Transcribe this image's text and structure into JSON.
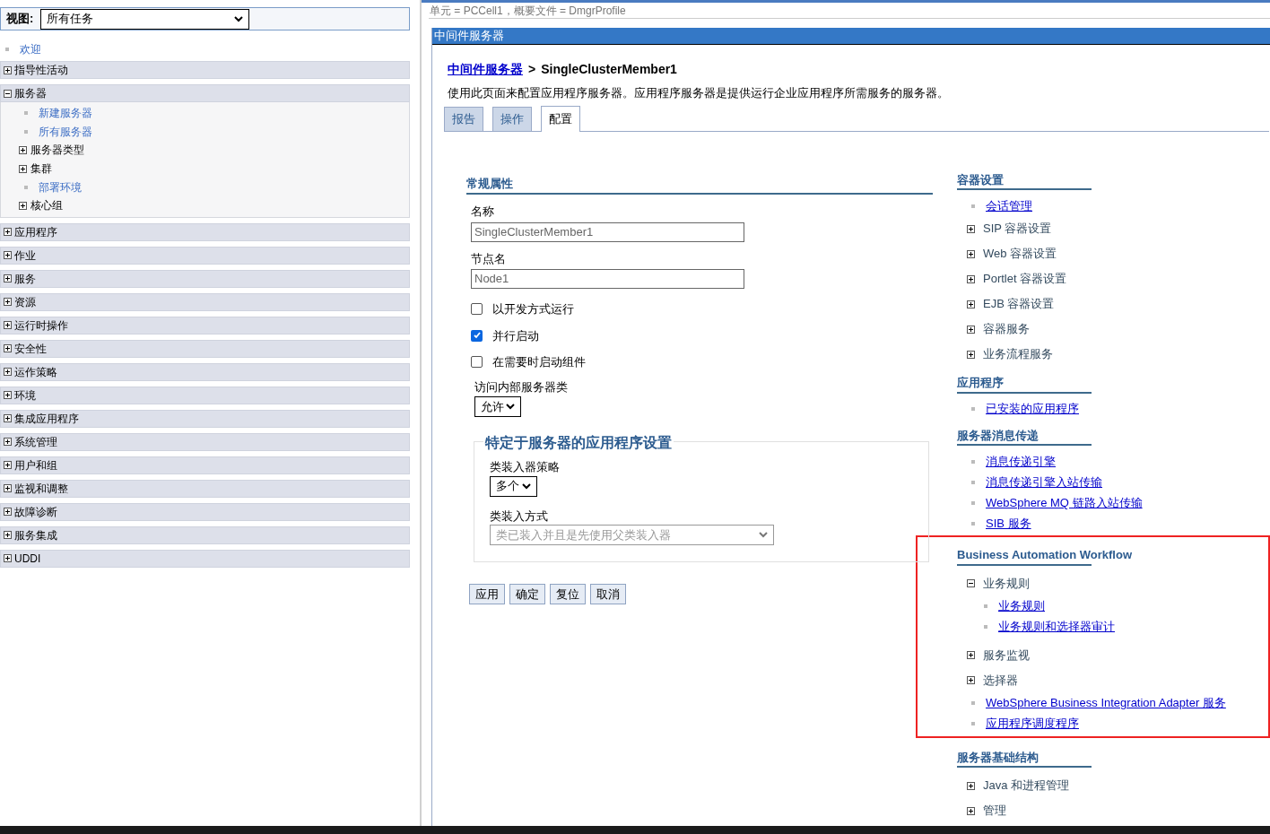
{
  "view": {
    "label": "视图:",
    "value": "所有任务"
  },
  "nav": [
    {
      "kind": "link",
      "label": "欢迎"
    },
    {
      "kind": "section",
      "label": "指导性活动",
      "expanded": false
    },
    {
      "kind": "section",
      "label": "服务器",
      "expanded": true,
      "children": [
        {
          "kind": "link",
          "label": "新建服务器"
        },
        {
          "kind": "link",
          "label": "所有服务器"
        },
        {
          "kind": "group",
          "label": "服务器类型",
          "expanded": false
        },
        {
          "kind": "group",
          "label": "集群",
          "expanded": false
        },
        {
          "kind": "link",
          "label": "部署环境"
        },
        {
          "kind": "group",
          "label": "核心组",
          "expanded": false
        }
      ]
    },
    {
      "kind": "section",
      "label": "应用程序",
      "expanded": false
    },
    {
      "kind": "section",
      "label": "作业",
      "expanded": false
    },
    {
      "kind": "section",
      "label": "服务",
      "expanded": false
    },
    {
      "kind": "section",
      "label": "资源",
      "expanded": false
    },
    {
      "kind": "section",
      "label": "运行时操作",
      "expanded": false
    },
    {
      "kind": "section",
      "label": "安全性",
      "expanded": false
    },
    {
      "kind": "section",
      "label": "运作策略",
      "expanded": false
    },
    {
      "kind": "section",
      "label": "环境",
      "expanded": false
    },
    {
      "kind": "section",
      "label": "集成应用程序",
      "expanded": false
    },
    {
      "kind": "section",
      "label": "系统管理",
      "expanded": false
    },
    {
      "kind": "section",
      "label": "用户和组",
      "expanded": false
    },
    {
      "kind": "section",
      "label": "监视和调整",
      "expanded": false
    },
    {
      "kind": "section",
      "label": "故障诊断",
      "expanded": false
    },
    {
      "kind": "section",
      "label": "服务集成",
      "expanded": false
    },
    {
      "kind": "section",
      "label": "UDDI",
      "expanded": false
    }
  ],
  "context": "单元 = PCCell1，概要文件 = DmgrProfile",
  "panel_title": "中间件服务器",
  "breadcrumb": {
    "link": "中间件服务器",
    "separator": ">",
    "current": "SingleClusterMember1"
  },
  "description": "使用此页面来配置应用程序服务器。应用程序服务器是提供运行企业应用程序所需服务的服务器。",
  "tabs": [
    {
      "label": "报告",
      "selected": false
    },
    {
      "label": "操作",
      "selected": false
    },
    {
      "label": "配置",
      "selected": true
    }
  ],
  "general": {
    "heading": "常规属性",
    "fields": [
      {
        "label": "名称",
        "value": "SingleClusterMember1"
      },
      {
        "label": "节点名",
        "value": "Node1"
      }
    ],
    "checkboxes": [
      {
        "label": "以开发方式运行",
        "checked": false
      },
      {
        "label": "并行启动",
        "checked": true
      },
      {
        "label": "在需要时启动组件",
        "checked": false
      }
    ],
    "select": {
      "label": "访问内部服务器类",
      "value": "允许"
    }
  },
  "app_settings": {
    "legend": "特定于服务器的应用程序设置",
    "policy": {
      "label": "类装入器策略",
      "value": "多个"
    },
    "mode": {
      "label": "类装入方式",
      "value": "类已装入并且是先使用父类装入器",
      "disabled": true
    }
  },
  "buttons": [
    "应用",
    "确定",
    "复位",
    "取消"
  ],
  "side_sections": [
    {
      "title": "容器设置",
      "highlighted": false,
      "items": [
        {
          "kind": "link",
          "label": "会话管理"
        },
        {
          "kind": "group",
          "label": "SIP 容器设置",
          "expanded": false
        },
        {
          "kind": "group",
          "label": "Web 容器设置",
          "expanded": false
        },
        {
          "kind": "group",
          "label": "Portlet 容器设置",
          "expanded": false
        },
        {
          "kind": "group",
          "label": "EJB 容器设置",
          "expanded": false
        },
        {
          "kind": "group",
          "label": "容器服务",
          "expanded": false
        },
        {
          "kind": "group",
          "label": "业务流程服务",
          "expanded": false
        }
      ]
    },
    {
      "title": "应用程序",
      "highlighted": false,
      "items": [
        {
          "kind": "link",
          "label": "已安装的应用程序"
        }
      ]
    },
    {
      "title": "服务器消息传递",
      "highlighted": false,
      "items": [
        {
          "kind": "link",
          "label": "消息传递引擎"
        },
        {
          "kind": "link",
          "label": "消息传递引擎入站传输"
        },
        {
          "kind": "link",
          "label": "WebSphere MQ 链路入站传输"
        },
        {
          "kind": "link",
          "label": "SIB 服务"
        }
      ]
    },
    {
      "title": "Business Automation Workflow",
      "highlighted": true,
      "items": [
        {
          "kind": "group",
          "label": "业务规则",
          "expanded": true,
          "children": [
            {
              "kind": "link",
              "label": "业务规则"
            },
            {
              "kind": "link",
              "label": "业务规则和选择器审计"
            }
          ]
        },
        {
          "kind": "group",
          "label": "服务监视",
          "expanded": false
        },
        {
          "kind": "group",
          "label": "选择器",
          "expanded": false
        },
        {
          "kind": "link",
          "label": "WebSphere Business Integration Adapter 服务"
        },
        {
          "kind": "link",
          "label": "应用程序调度程序"
        }
      ]
    },
    {
      "title": "服务器基础结构",
      "highlighted": false,
      "items": [
        {
          "kind": "group",
          "label": "Java 和进程管理",
          "expanded": false
        },
        {
          "kind": "group",
          "label": "管理",
          "expanded": false
        }
      ]
    }
  ]
}
